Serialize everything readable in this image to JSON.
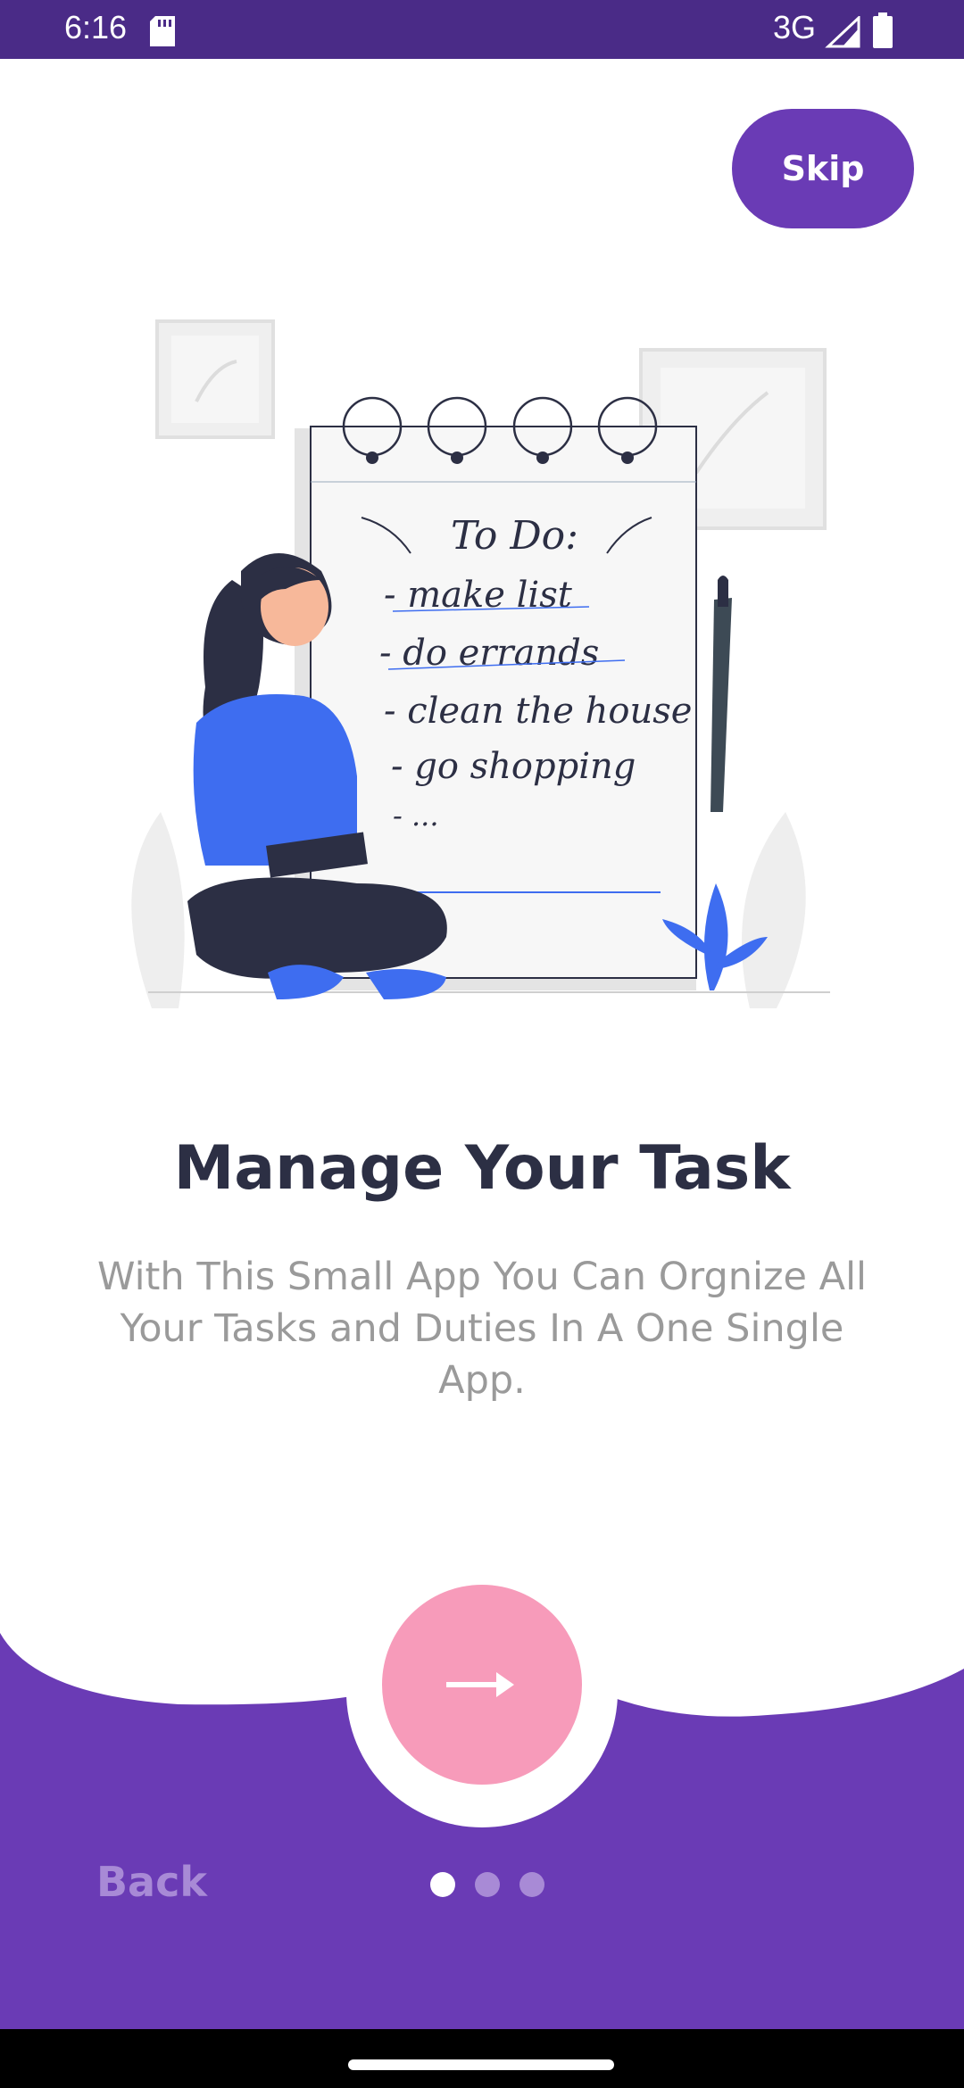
{
  "status_bar": {
    "time": "6:16",
    "network": "3G"
  },
  "skip_label": "Skip",
  "illustration": {
    "heading": "To Do:",
    "items": [
      "- make list",
      "- do errands",
      "- clean the house",
      "- go shopping",
      "- ..."
    ]
  },
  "title": "Manage Your Task",
  "subtitle": "With This Small App You Can Orgnize All Your Tasks and Duties In A One Single App.",
  "back_label": "Back",
  "pagination": {
    "total": 3,
    "active": 1
  },
  "colors": {
    "primary": "#6a3bb5",
    "status_bar": "#4a2b87",
    "next_button": "#f79bba",
    "title": "#2c2f44",
    "subtitle": "#9a9a9a",
    "accent_blue": "#3e6df0"
  }
}
